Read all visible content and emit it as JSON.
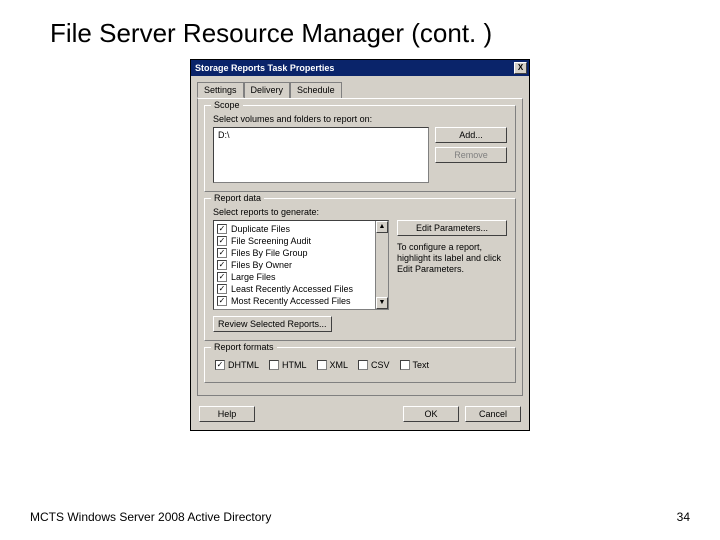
{
  "slide": {
    "title": "File Server Resource Manager (cont. )",
    "footer_text": "MCTS Windows Server 2008 Active Directory",
    "page_number": "34"
  },
  "dialog": {
    "title": "Storage Reports Task Properties",
    "close": "X",
    "tabs": {
      "settings": "Settings",
      "delivery": "Delivery",
      "schedule": "Schedule"
    },
    "scope": {
      "legend": "Scope",
      "label": "Select volumes and folders to report on:",
      "item": "D:\\",
      "add": "Add...",
      "remove": "Remove"
    },
    "reportdata": {
      "legend": "Report data",
      "label": "Select reports to generate:",
      "items": {
        "0": "Duplicate Files",
        "1": "File Screening Audit",
        "2": "Files By File Group",
        "3": "Files By Owner",
        "4": "Large Files",
        "5": "Least Recently Accessed Files",
        "6": "Most Recently Accessed Files"
      },
      "edit_parameters": "Edit Parameters...",
      "hint": "To configure a report, highlight its label and click Edit Parameters.",
      "review": "Review Selected Reports..."
    },
    "formats": {
      "legend": "Report formats",
      "dhtml": "DHTML",
      "html": "HTML",
      "xml": "XML",
      "csv": "CSV",
      "text": "Text"
    },
    "buttons": {
      "help": "Help",
      "ok": "OK",
      "cancel": "Cancel"
    },
    "checkmark": "✓",
    "arrow_up": "▲",
    "arrow_down": "▼"
  }
}
